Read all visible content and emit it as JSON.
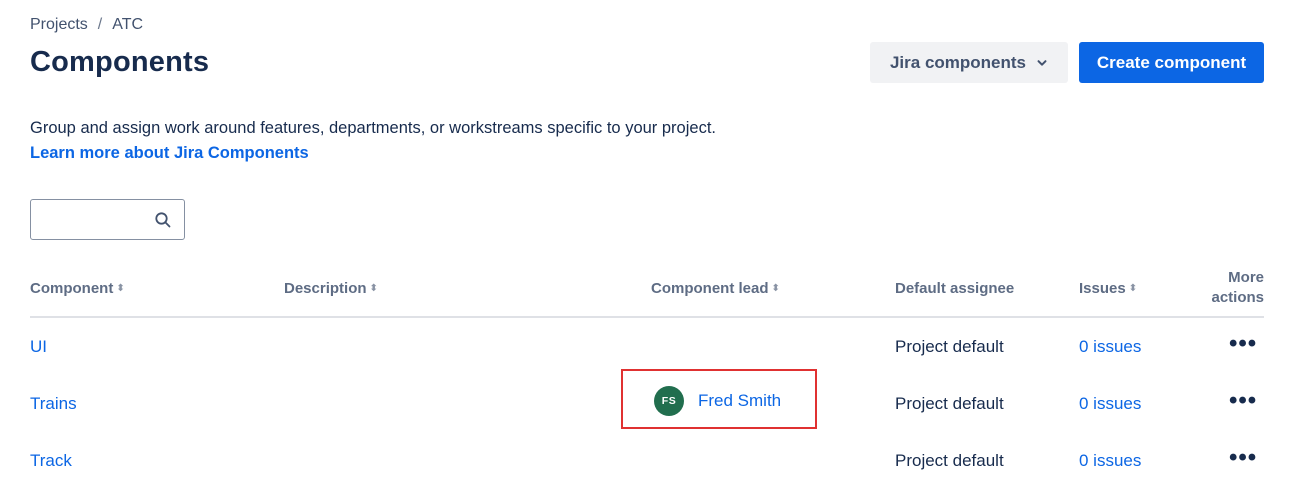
{
  "breadcrumb": {
    "items": [
      "Projects",
      "ATC"
    ],
    "separator": "/"
  },
  "page_title": "Components",
  "header_actions": {
    "secondary_label": "Jira components",
    "primary_label": "Create component"
  },
  "intro": {
    "description": "Group and assign work around features, departments, or workstreams specific to your project.",
    "learn_more": "Learn more about Jira Components"
  },
  "search": {
    "value": "",
    "placeholder": ""
  },
  "table": {
    "columns": {
      "component": "Component",
      "description": "Description",
      "component_lead": "Component lead",
      "default_assignee": "Default assignee",
      "issues": "Issues",
      "more_actions": "More actions"
    },
    "rows": [
      {
        "component": "UI",
        "description": "",
        "lead": "",
        "lead_initials": "",
        "default_assignee": "Project default",
        "issues": "0 issues"
      },
      {
        "component": "Trains",
        "description": "",
        "lead": "Fred Smith",
        "lead_initials": "FS",
        "default_assignee": "Project default",
        "issues": "0 issues"
      },
      {
        "component": "Track",
        "description": "",
        "lead": "",
        "lead_initials": "",
        "default_assignee": "Project default",
        "issues": "0 issues"
      }
    ]
  },
  "colors": {
    "accent": "#0c66e4",
    "avatar": "#216e4e",
    "highlight": "#e03131"
  },
  "icons": {
    "search": "search-icon",
    "dropdown": "chevron-down-icon",
    "more": "more-icon"
  }
}
